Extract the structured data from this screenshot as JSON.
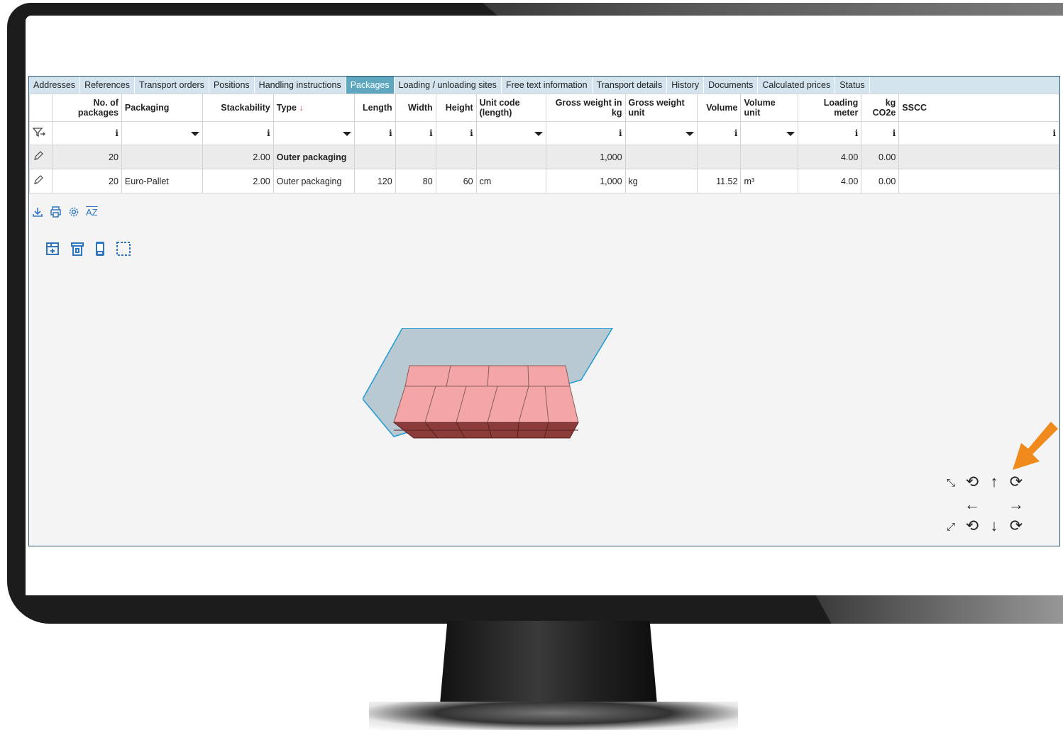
{
  "tabs": [
    {
      "label": "Addresses"
    },
    {
      "label": "References"
    },
    {
      "label": "Transport orders"
    },
    {
      "label": "Positions"
    },
    {
      "label": "Handling instructions"
    },
    {
      "label": "Packages",
      "active": true
    },
    {
      "label": "Loading / unloading sites"
    },
    {
      "label": "Free text information"
    },
    {
      "label": "Transport details"
    },
    {
      "label": "History"
    },
    {
      "label": "Documents"
    },
    {
      "label": "Calculated prices"
    },
    {
      "label": "Status"
    }
  ],
  "columns": {
    "no_packages_1": "No. of",
    "no_packages_2": "packages",
    "packaging": "Packaging",
    "stackability": "Stackability",
    "type": "Type",
    "type_sort": "↓",
    "length": "Length",
    "width": "Width",
    "height": "Height",
    "unit_code_1": "Unit code",
    "unit_code_2": "(length)",
    "gross_weight_1": "Gross weight in",
    "gross_weight_2": "kg",
    "gross_weight_unit_1": "Gross weight",
    "gross_weight_unit_2": "unit",
    "volume": "Volume",
    "volume_unit_1": "Volume",
    "volume_unit_2": "unit",
    "loading_meter_1": "Loading",
    "loading_meter_2": "meter",
    "co2_1": "kg",
    "co2_2": "CO2e",
    "sscc": "SSCC"
  },
  "filter_info_glyph": "i",
  "rows": [
    {
      "no_packages": "20",
      "packaging": "",
      "stackability": "2.00",
      "type": "Outer packaging",
      "length": "",
      "width": "",
      "height": "",
      "unit_code": "",
      "gross_weight": "1,000",
      "gross_weight_unit": "",
      "volume": "",
      "volume_unit": "",
      "loading_meter": "4.00",
      "co2": "0.00",
      "sscc": ""
    },
    {
      "no_packages": "20",
      "packaging": "Euro-Pallet",
      "stackability": "2.00",
      "type": "Outer packaging",
      "length": "120",
      "width": "80",
      "height": "60",
      "unit_code": "cm",
      "gross_weight": "1,000",
      "gross_weight_unit": "kg",
      "volume": "11.52",
      "volume_unit": "m³",
      "loading_meter": "4.00",
      "co2": "0.00",
      "sscc": ""
    }
  ],
  "toolbar": {
    "sort_label": "AZ"
  },
  "icons": {
    "filter": "filter-icon",
    "edit": "pencil-icon",
    "download": "download-icon",
    "print": "print-icon",
    "settings": "gear-icon",
    "sort": "sort-az-icon",
    "add_box": "add-package-icon",
    "delete": "delete-icon",
    "device": "device-icon",
    "select": "select-area-icon"
  },
  "colors": {
    "active_tab": "#5fa7bf",
    "tab_bar": "#d4e4ef",
    "package_face": "#f4a6a6",
    "package_side": "#8c3b3b",
    "container": "#b8c9d1",
    "pointer_arrow": "#f08a1c",
    "toolbar_icon": "#2f76c0"
  }
}
